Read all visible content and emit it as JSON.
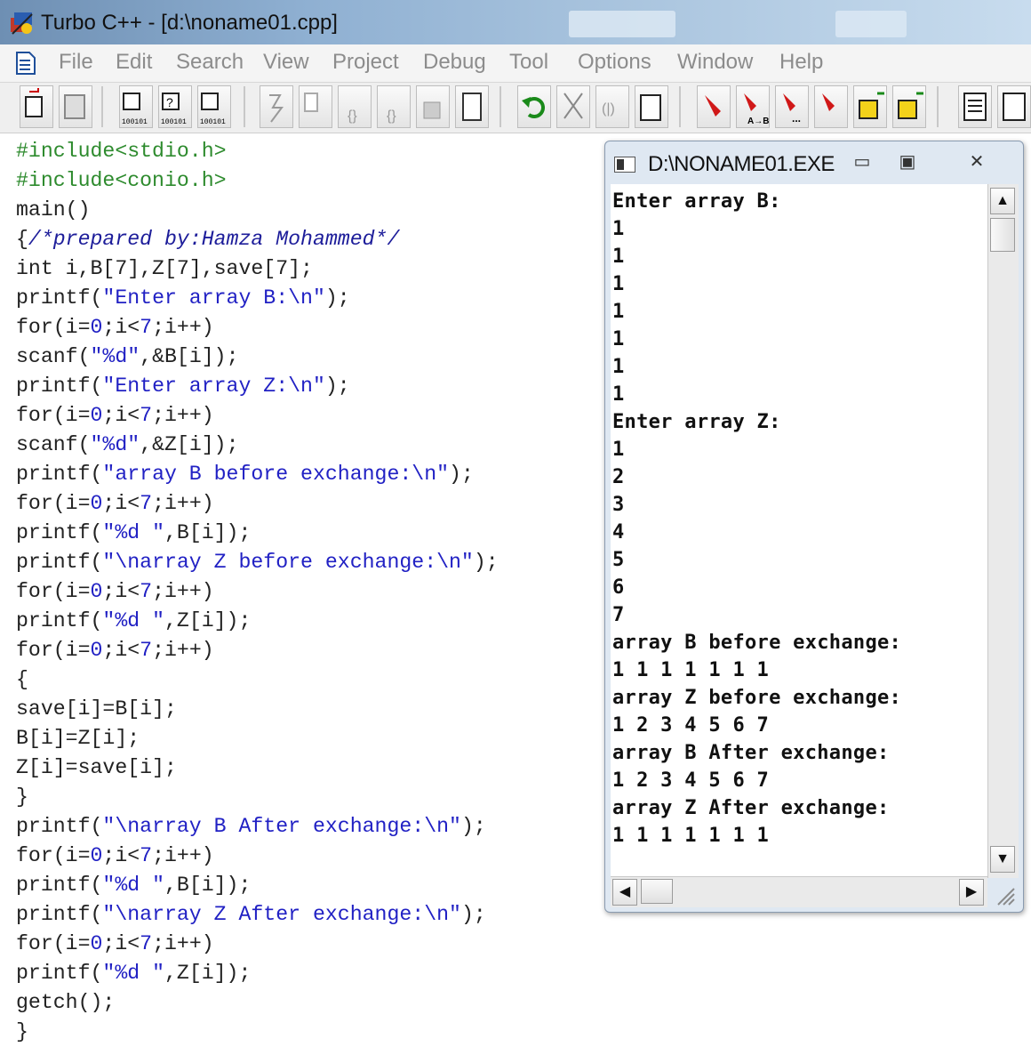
{
  "window": {
    "title": "Turbo C++ - [d:\\noname01.cpp]"
  },
  "menu": [
    "File",
    "Edit",
    "Search",
    "View",
    "Project",
    "Debug",
    "Tool",
    "Options",
    "Window",
    "Help"
  ],
  "toolbar": {
    "icons": [
      "open-file-icon",
      "save-icon",
      "compile-icon",
      "compile-help-icon",
      "build-icon",
      "make-icon",
      "run-icon",
      "step-icon",
      "trace-icon",
      "watch-icon",
      "breakpoint-icon",
      "evaluate-icon",
      "undo-icon",
      "cut-icon",
      "copy-icon",
      "paste-icon",
      "find-icon",
      "replace-icon",
      "search-again-icon",
      "go-to-icon",
      "import-icon",
      "export-icon",
      "message-window-icon",
      "output-window-icon"
    ]
  },
  "editor": {
    "lines": [
      [
        {
          "t": "#include<stdio.h>",
          "c": "pre"
        }
      ],
      [
        {
          "t": "#include<conio.h>",
          "c": "pre"
        }
      ],
      [
        {
          "t": "main()",
          "c": ""
        }
      ],
      [
        {
          "t": "{",
          "c": ""
        },
        {
          "t": "/*prepared by:Hamza Mohammed*/",
          "c": "cmt"
        }
      ],
      [
        {
          "t": "int i,B[7],Z[7],save[7];",
          "c": ""
        }
      ],
      [
        {
          "t": "printf(",
          "c": ""
        },
        {
          "t": "\"Enter array B:\\n\"",
          "c": "str"
        },
        {
          "t": ");",
          "c": ""
        }
      ],
      [
        {
          "t": "for(i=",
          "c": ""
        },
        {
          "t": "0",
          "c": "num"
        },
        {
          "t": ";i<",
          "c": ""
        },
        {
          "t": "7",
          "c": "num"
        },
        {
          "t": ";i++)",
          "c": ""
        }
      ],
      [
        {
          "t": "scanf(",
          "c": ""
        },
        {
          "t": "\"%d\"",
          "c": "str"
        },
        {
          "t": ",&B[i]);",
          "c": ""
        }
      ],
      [
        {
          "t": "printf(",
          "c": ""
        },
        {
          "t": "\"Enter array Z:\\n\"",
          "c": "str"
        },
        {
          "t": ");",
          "c": ""
        }
      ],
      [
        {
          "t": "for(i=",
          "c": ""
        },
        {
          "t": "0",
          "c": "num"
        },
        {
          "t": ";i<",
          "c": ""
        },
        {
          "t": "7",
          "c": "num"
        },
        {
          "t": ";i++)",
          "c": ""
        }
      ],
      [
        {
          "t": "scanf(",
          "c": ""
        },
        {
          "t": "\"%d\"",
          "c": "str"
        },
        {
          "t": ",&Z[i]);",
          "c": ""
        }
      ],
      [
        {
          "t": "printf(",
          "c": ""
        },
        {
          "t": "\"array B before exchange:\\n\"",
          "c": "str"
        },
        {
          "t": ");",
          "c": ""
        }
      ],
      [
        {
          "t": "for(i=",
          "c": ""
        },
        {
          "t": "0",
          "c": "num"
        },
        {
          "t": ";i<",
          "c": ""
        },
        {
          "t": "7",
          "c": "num"
        },
        {
          "t": ";i++)",
          "c": ""
        }
      ],
      [
        {
          "t": "printf(",
          "c": ""
        },
        {
          "t": "\"%d \"",
          "c": "str"
        },
        {
          "t": ",B[i]);",
          "c": ""
        }
      ],
      [
        {
          "t": "printf(",
          "c": ""
        },
        {
          "t": "\"\\narray Z before exchange:\\n\"",
          "c": "str"
        },
        {
          "t": ");",
          "c": ""
        }
      ],
      [
        {
          "t": "for(i=",
          "c": ""
        },
        {
          "t": "0",
          "c": "num"
        },
        {
          "t": ";i<",
          "c": ""
        },
        {
          "t": "7",
          "c": "num"
        },
        {
          "t": ";i++)",
          "c": ""
        }
      ],
      [
        {
          "t": "printf(",
          "c": ""
        },
        {
          "t": "\"%d \"",
          "c": "str"
        },
        {
          "t": ",Z[i]);",
          "c": ""
        }
      ],
      [
        {
          "t": "for(i=",
          "c": ""
        },
        {
          "t": "0",
          "c": "num"
        },
        {
          "t": ";i<",
          "c": ""
        },
        {
          "t": "7",
          "c": "num"
        },
        {
          "t": ";i++)",
          "c": ""
        }
      ],
      [
        {
          "t": "{",
          "c": ""
        }
      ],
      [
        {
          "t": "save[i]=B[i];",
          "c": ""
        }
      ],
      [
        {
          "t": "B[i]=Z[i];",
          "c": ""
        }
      ],
      [
        {
          "t": "Z[i]=save[i];",
          "c": ""
        }
      ],
      [
        {
          "t": "}",
          "c": ""
        }
      ],
      [
        {
          "t": "printf(",
          "c": ""
        },
        {
          "t": "\"\\narray B After exchange:\\n\"",
          "c": "str"
        },
        {
          "t": ");",
          "c": ""
        }
      ],
      [
        {
          "t": "for(i=",
          "c": ""
        },
        {
          "t": "0",
          "c": "num"
        },
        {
          "t": ";i<",
          "c": ""
        },
        {
          "t": "7",
          "c": "num"
        },
        {
          "t": ";i++)",
          "c": ""
        }
      ],
      [
        {
          "t": "printf(",
          "c": ""
        },
        {
          "t": "\"%d \"",
          "c": "str"
        },
        {
          "t": ",B[i]);",
          "c": ""
        }
      ],
      [
        {
          "t": "printf(",
          "c": ""
        },
        {
          "t": "\"\\narray Z After exchange:\\n\"",
          "c": "str"
        },
        {
          "t": ");",
          "c": ""
        }
      ],
      [
        {
          "t": "for(i=",
          "c": ""
        },
        {
          "t": "0",
          "c": "num"
        },
        {
          "t": ";i<",
          "c": ""
        },
        {
          "t": "7",
          "c": "num"
        },
        {
          "t": ";i++)",
          "c": ""
        }
      ],
      [
        {
          "t": "printf(",
          "c": ""
        },
        {
          "t": "\"%d \"",
          "c": "str"
        },
        {
          "t": ",Z[i]);",
          "c": ""
        }
      ],
      [
        {
          "t": "getch();",
          "c": ""
        }
      ],
      [
        {
          "t": "}",
          "c": ""
        }
      ]
    ]
  },
  "console": {
    "title": "D:\\NONAME01.EXE",
    "buttons": {
      "minimize": "▭",
      "maximize": "▣",
      "close": "✕"
    },
    "scroll": {
      "up": "▲",
      "down": "▼",
      "left": "◀",
      "right": "▶"
    },
    "output": [
      "Enter array B:",
      "1",
      "1",
      "1",
      "1",
      "1",
      "1",
      "1",
      "Enter array Z:",
      "1",
      "2",
      "3",
      "4",
      "5",
      "6",
      "7",
      "array B before exchange:",
      "1 1 1 1 1 1 1",
      "array Z before exchange:",
      "1 2 3 4 5 6 7",
      "array B After exchange:",
      "1 2 3 4 5 6 7",
      "array Z After exchange:",
      "1 1 1 1 1 1 1"
    ]
  },
  "colors": {
    "preprocessor": "#2e8b2e",
    "string": "#2121c4",
    "comment": "#1d1d9a",
    "code": "#222222"
  }
}
